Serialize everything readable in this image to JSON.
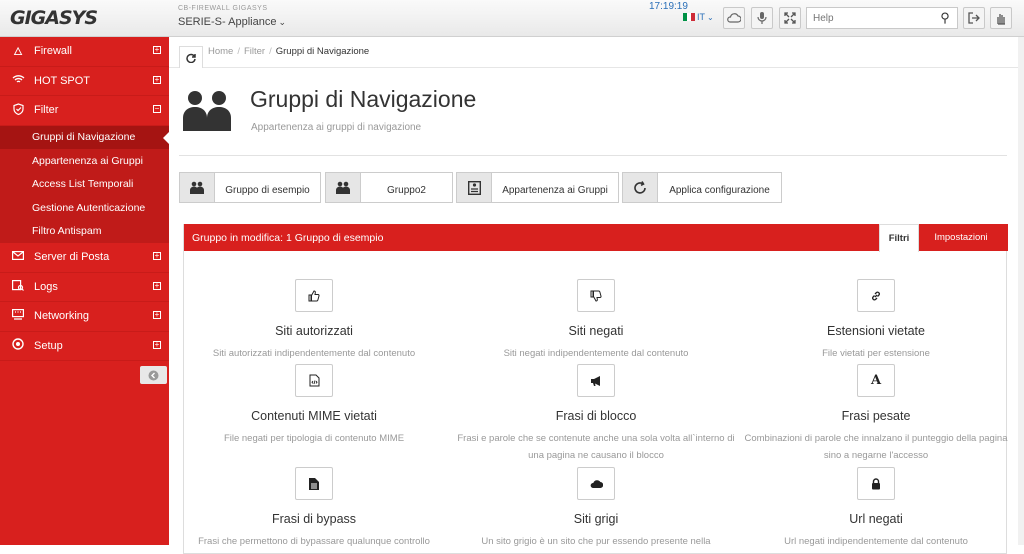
{
  "topbar": {
    "logo": "GIGASYS",
    "subtitle": "CB-FIREWALL GIGASYS",
    "appliance": "SERIE-S- Appliance",
    "time": "17:19:19",
    "lang": "IT",
    "help_placeholder": "Help"
  },
  "sidebar": {
    "items": [
      {
        "label": "Firewall",
        "icon": "fire-icon"
      },
      {
        "label": "HOT SPOT",
        "icon": "wifi-icon"
      },
      {
        "label": "Filter",
        "icon": "shield-icon"
      },
      {
        "label": "Server di Posta",
        "icon": "mail-icon"
      },
      {
        "label": "Logs",
        "icon": "logs-icon"
      },
      {
        "label": "Networking",
        "icon": "network-icon"
      },
      {
        "label": "Setup",
        "icon": "setup-icon"
      }
    ],
    "filter_sub": [
      {
        "label": "Gruppi di Navigazione",
        "active": true
      },
      {
        "label": "Appartenenza ai Gruppi",
        "active": false
      },
      {
        "label": "Access List Temporali",
        "active": false
      },
      {
        "label": "Gestione Autenticazione",
        "active": false
      },
      {
        "label": "Filtro Antispam",
        "active": false
      }
    ]
  },
  "breadcrumb": {
    "home": "Home",
    "filter": "Filter",
    "current": "Gruppi di Navigazione"
  },
  "page": {
    "title": "Gruppi di Navigazione",
    "description": "Appartenenza ai gruppi di navigazione"
  },
  "group_buttons": [
    {
      "label": "Gruppo di esempio",
      "icon": "users-icon"
    },
    {
      "label": "Gruppo2",
      "icon": "users-icon"
    },
    {
      "label": "Appartenenza ai Gruppi",
      "icon": "list-icon"
    },
    {
      "label": "Applica configurazione",
      "icon": "refresh-icon"
    }
  ],
  "panel": {
    "title": "Gruppo in modifica: 1 Gruppo di esempio",
    "tab_active": "Filtri",
    "tab_other": "Impostazioni"
  },
  "features": [
    {
      "title": "Siti autorizzati",
      "desc": "Siti autorizzati indipendentemente dal contenuto",
      "icon": "thumbs-up-icon"
    },
    {
      "title": "Siti negati",
      "desc": "Siti negati indipendentemente dal contenuto",
      "icon": "thumbs-down-icon"
    },
    {
      "title": "Estensioni vietate",
      "desc": "File vietati per estensione",
      "icon": "link-icon"
    },
    {
      "title": "Contenuti MIME vietati",
      "desc": "File negati per tipologia di contenuto MIME",
      "icon": "code-file-icon"
    },
    {
      "title": "Frasi di blocco",
      "desc": "Frasi e parole che se contenute anche una sola volta all`interno di una pagina ne causano il blocco",
      "icon": "megaphone-icon"
    },
    {
      "title": "Frasi pesate",
      "desc": "Combinazioni di parole che innalzano il punteggio della pagina sino a negarne l'accesso",
      "icon": "font-icon"
    },
    {
      "title": "Frasi di bypass",
      "desc": "Frasi che permettono di bypassare qualunque controllo",
      "icon": "file-icon"
    },
    {
      "title": "Siti grigi",
      "desc": "Un sito grigio è un sito che pur essendo presente nella",
      "icon": "cloud-icon"
    },
    {
      "title": "Url negati",
      "desc": "Url negati indipendentemente dal contenuto",
      "icon": "lock-icon"
    }
  ],
  "colors": {
    "accent": "#d8201e",
    "link": "#2a6fb8"
  }
}
